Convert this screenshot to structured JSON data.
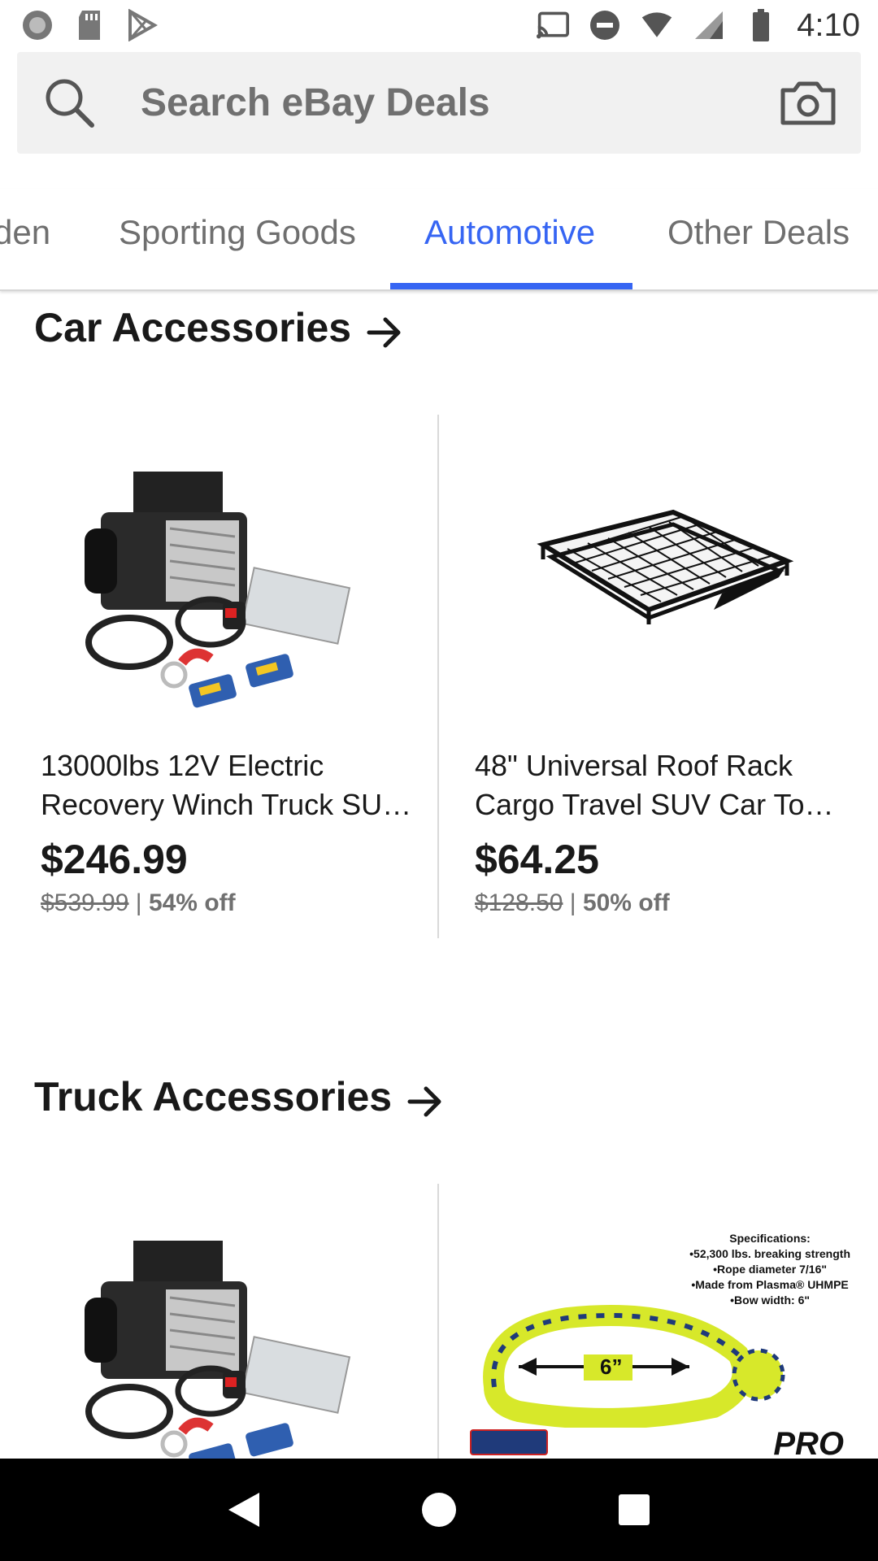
{
  "status_bar": {
    "time": "4:10",
    "left_icons": [
      "record-icon",
      "sd-card-icon",
      "play-store-icon"
    ],
    "right_icons": [
      "cast-icon",
      "do-not-disturb-icon",
      "wifi-icon",
      "signal-icon",
      "battery-icon"
    ]
  },
  "search": {
    "placeholder": "Search eBay Deals"
  },
  "tabs": [
    {
      "label": "den",
      "active": false
    },
    {
      "label": "Sporting Goods",
      "active": false
    },
    {
      "label": "Automotive",
      "active": true
    },
    {
      "label": "Other Deals",
      "active": false
    }
  ],
  "sections": [
    {
      "title": "Car Accessories",
      "products": [
        {
          "title": "13000lbs 12V Electric Recovery Winch Truck SU…",
          "price": "$246.99",
          "original_price": "$539.99",
          "separator": "|",
          "discount": "54% off",
          "image": "winch-image"
        },
        {
          "title": "48\" Universal Roof Rack Cargo Travel SUV Car To…",
          "price": "$64.25",
          "original_price": "$128.50",
          "separator": "|",
          "discount": "50% off",
          "image": "roof-rack-image"
        }
      ]
    },
    {
      "title": "Truck Accessories",
      "products": [
        {
          "image": "winch-image"
        },
        {
          "image": "rope-shackle-image",
          "image_text": {
            "spec_heading": "Specifications:",
            "spec_lines": [
              "•52,300 lbs. breaking strength",
              "•Rope diameter 7/16\"",
              "•Made from Plasma® UHMPE",
              "•Bow width: 6\""
            ],
            "size_label": "6”",
            "brand": "PRO"
          }
        }
      ]
    }
  ],
  "colors": {
    "accent": "#3665f3",
    "text": "#191919",
    "muted": "#707070"
  }
}
